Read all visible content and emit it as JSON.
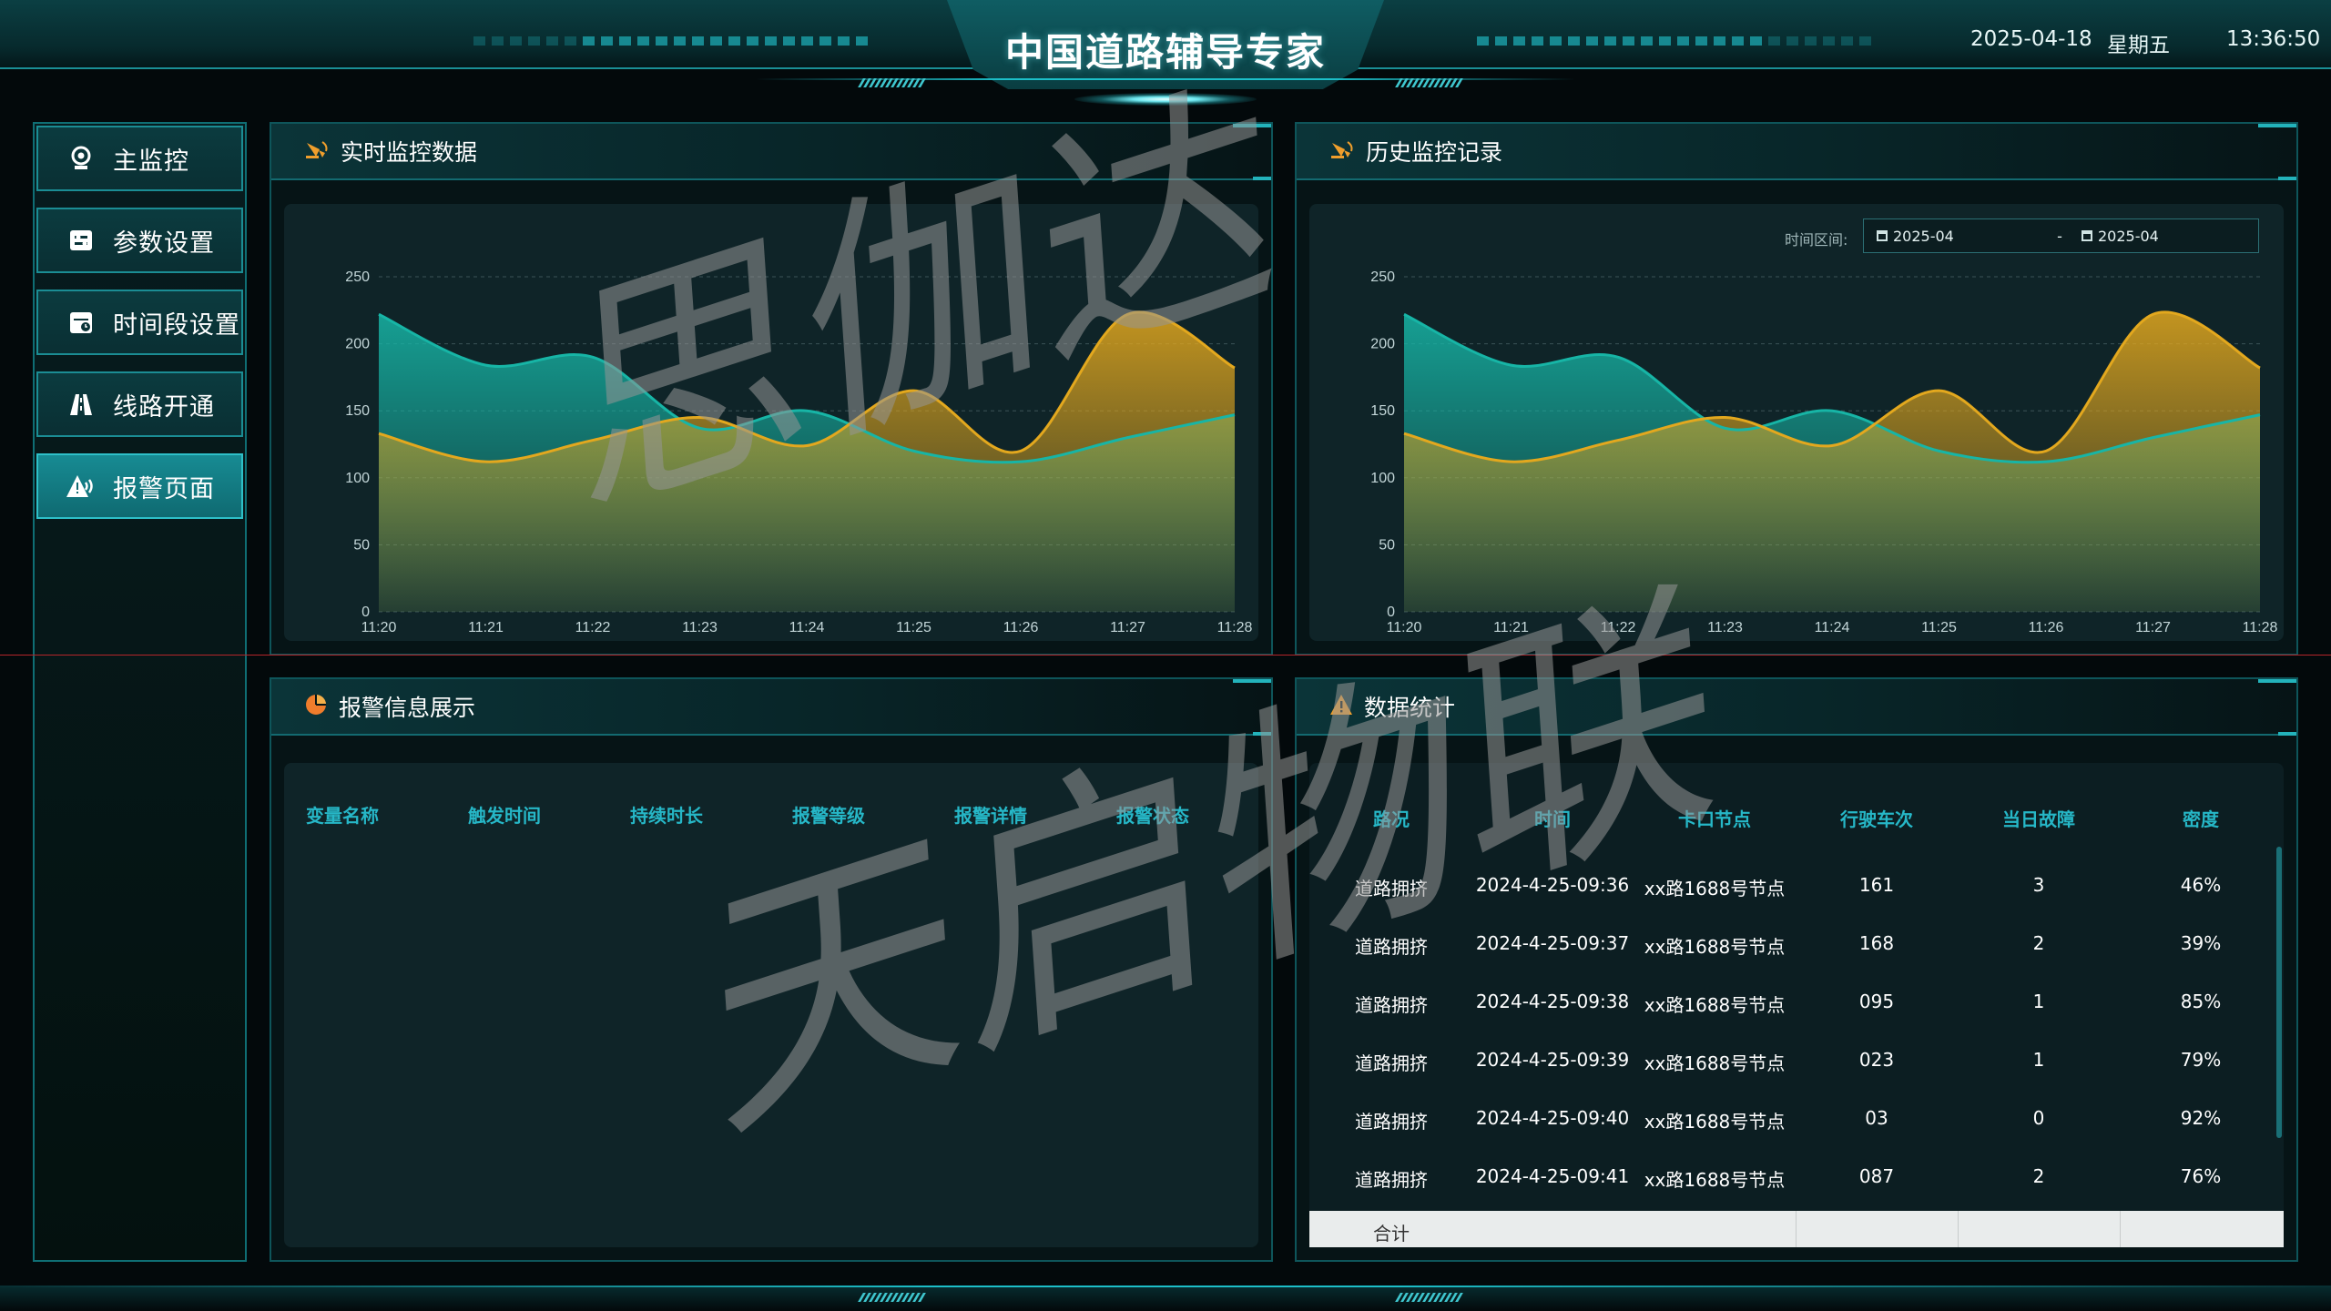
{
  "header": {
    "title": "中国道路辅导专家",
    "date": "2025-04-18",
    "weekday": "星期五",
    "time": "13:36:50"
  },
  "sidebar": {
    "items": [
      {
        "label": "主监控",
        "icon": "camera-icon",
        "active": false
      },
      {
        "label": "参数设置",
        "icon": "settings-sliders-icon",
        "active": false
      },
      {
        "label": "时间段设置",
        "icon": "calendar-icon",
        "active": false
      },
      {
        "label": "线路开通",
        "icon": "road-icon",
        "active": false
      },
      {
        "label": "报警页面",
        "icon": "alarm-icon",
        "active": true
      }
    ]
  },
  "realtime": {
    "title": "实时监控数据",
    "icon": "monitor-icon"
  },
  "history": {
    "title": "历史监控记录",
    "icon": "monitor-icon",
    "range_label": "时间区间:",
    "range_start": "2025-04",
    "range_sep": "-",
    "range_end": "2025-04"
  },
  "chart_data": [
    {
      "type": "area",
      "x": [
        "11:20",
        "11:21",
        "11:22",
        "11:23",
        "11:24",
        "11:25",
        "11:26",
        "11:27",
        "11:28"
      ],
      "ylim": [
        0,
        250
      ],
      "yticks": [
        0,
        50,
        100,
        150,
        200,
        250
      ],
      "grid": true,
      "series": [
        {
          "color": "#17b5a6",
          "values": [
            222,
            184,
            190,
            137,
            150,
            120,
            112,
            130,
            147
          ]
        },
        {
          "color": "#e3a81e",
          "values": [
            133,
            112,
            128,
            145,
            124,
            165,
            120,
            222,
            182
          ]
        }
      ]
    },
    {
      "type": "area",
      "x": [
        "11:20",
        "11:21",
        "11:22",
        "11:23",
        "11:24",
        "11:25",
        "11:26",
        "11:27",
        "11:28"
      ],
      "ylim": [
        0,
        250
      ],
      "yticks": [
        0,
        50,
        100,
        150,
        200,
        250
      ],
      "grid": true,
      "series": [
        {
          "color": "#17b5a6",
          "values": [
            222,
            184,
            190,
            137,
            150,
            120,
            112,
            130,
            147
          ]
        },
        {
          "color": "#e3a81e",
          "values": [
            133,
            112,
            128,
            145,
            124,
            165,
            120,
            222,
            182
          ]
        }
      ]
    }
  ],
  "alarm": {
    "title": "报警信息展示",
    "icon": "pie-chart-icon",
    "columns": [
      "变量名称",
      "触发时间",
      "持续时长",
      "报警等级",
      "报警详情",
      "报警状态"
    ]
  },
  "stats": {
    "title": "数据统计",
    "icon": "warning-triangle-icon",
    "columns": [
      "路况",
      "时间",
      "卡口节点",
      "行驶车次",
      "当日故障",
      "密度"
    ],
    "rows": [
      [
        "道路拥挤",
        "2024-4-25-09:36",
        "xx路1688号节点",
        "161",
        "3",
        "46%"
      ],
      [
        "道路拥挤",
        "2024-4-25-09:37",
        "xx路1688号节点",
        "168",
        "2",
        "39%"
      ],
      [
        "道路拥挤",
        "2024-4-25-09:38",
        "xx路1688号节点",
        "095",
        "1",
        "85%"
      ],
      [
        "道路拥挤",
        "2024-4-25-09:39",
        "xx路1688号节点",
        "023",
        "1",
        "79%"
      ],
      [
        "道路拥挤",
        "2024-4-25-09:40",
        "xx路1688号节点",
        "03",
        "0",
        "92%"
      ],
      [
        "道路拥挤",
        "2024-4-25-09:41",
        "xx路1688号节点",
        "087",
        "2",
        "76%"
      ]
    ],
    "total_label": "合计"
  },
  "watermarks": [
    "思伽达",
    "天启物联"
  ]
}
